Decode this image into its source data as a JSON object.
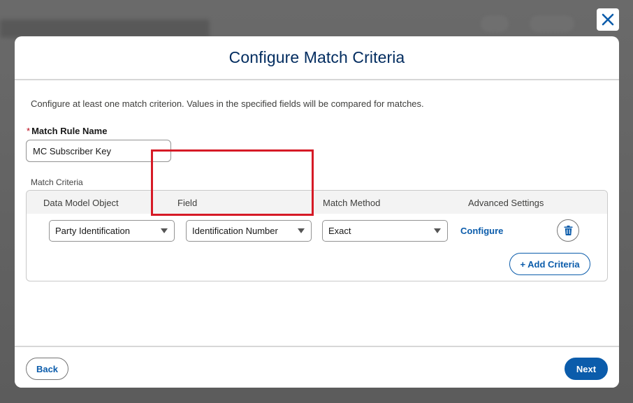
{
  "modal": {
    "title": "Configure Match Criteria",
    "intro": "Configure at least one match criterion. Values in the specified fields will be compared for matches.",
    "rule_name": {
      "required_marker": "*",
      "label": "Match Rule Name",
      "value": "MC Subscriber Key"
    },
    "criteria": {
      "section_label": "Match Criteria",
      "columns": [
        "Data Model Object",
        "Field",
        "Match Method",
        "Advanced Settings"
      ],
      "rows": [
        {
          "data_model_object": "Party Identification",
          "field": "Identification Number",
          "match_method": "Exact",
          "advanced_settings_link": "Configure"
        }
      ],
      "add_button": "+ Add Criteria"
    }
  },
  "footer": {
    "back": "Back",
    "next": "Next"
  },
  "icons": {
    "close": "close-icon",
    "delete": "trash-icon",
    "dropdown": "chevron-down-icon"
  },
  "colors": {
    "brand": "#0b5cab",
    "title": "#032d60",
    "highlight": "#d61a26",
    "required": "#ba0517"
  }
}
